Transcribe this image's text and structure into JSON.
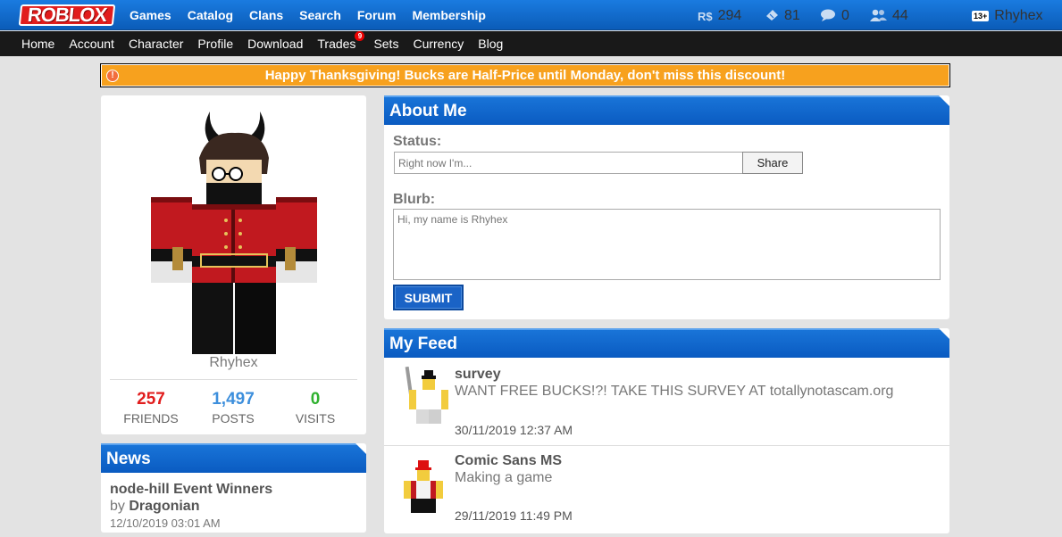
{
  "topbar": {
    "logo": "ROBLOX",
    "nav": [
      "Games",
      "Catalog",
      "Clans",
      "Search",
      "Forum",
      "Membership"
    ],
    "robux": "294",
    "tickets": "81",
    "messages": "0",
    "friend_requests": "44",
    "age_badge": "13+",
    "username": "Rhyhex"
  },
  "subnav": {
    "items": [
      "Home",
      "Account",
      "Character",
      "Profile",
      "Download",
      "Trades",
      "Sets",
      "Currency",
      "Blog"
    ],
    "trades_badge": "9"
  },
  "banner": {
    "text": "Happy Thanksgiving! Bucks are Half-Price until Monday, don't miss this discount!",
    "color": "#f7a11e"
  },
  "profile": {
    "username": "Rhyhex",
    "friends": "257",
    "friends_label": "FRIENDS",
    "posts": "1,497",
    "posts_label": "POSTS",
    "visits": "0",
    "visits_label": "VISITS",
    "colors": {
      "friends": "#e11d1d",
      "posts": "#3d8fdc",
      "visits": "#2fb12f"
    }
  },
  "about": {
    "title": "About Me",
    "status_label": "Status:",
    "status_placeholder": "Right now I'm...",
    "share_label": "Share",
    "blurb_label": "Blurb:",
    "blurb_placeholder": "Hi, my name is Rhyhex",
    "submit_label": "SUBMIT"
  },
  "feed": {
    "title": "My Feed",
    "posts": [
      {
        "user": "survey",
        "text": "WANT FREE BUCKS!?! TAKE THIS SURVEY AT totallynotascam.org",
        "date": "30/11/2019 12:37 AM"
      },
      {
        "user": "Comic Sans MS",
        "text": "Making a game",
        "date": "29/11/2019 11:49 PM"
      }
    ]
  },
  "news": {
    "title": "News",
    "items": [
      {
        "title": "node-hill Event Winners",
        "by_prefix": "by",
        "author": "Dragonian",
        "date": "12/10/2019 03:01 AM"
      }
    ]
  }
}
